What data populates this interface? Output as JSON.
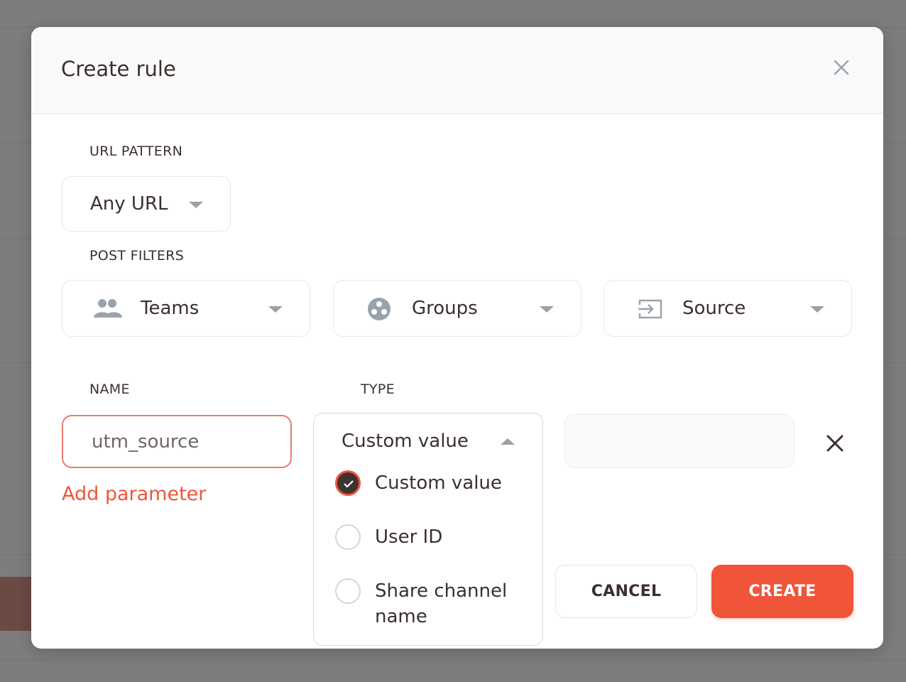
{
  "modal": {
    "title": "Create rule"
  },
  "url_pattern": {
    "label": "URL PATTERN",
    "value": "Any URL"
  },
  "post_filters": {
    "label": "POST FILTERS",
    "items": [
      {
        "label": "Teams",
        "icon": "people-icon"
      },
      {
        "label": "Groups",
        "icon": "groups-icon"
      },
      {
        "label": "Source",
        "icon": "source-icon"
      }
    ]
  },
  "name_field": {
    "label": "NAME",
    "value": "utm_source"
  },
  "type_field": {
    "label": "TYPE",
    "selected": "Custom value",
    "options": [
      {
        "label": "Custom value",
        "checked": true
      },
      {
        "label": "User ID",
        "checked": false
      },
      {
        "label": "Share channel name",
        "checked": false
      }
    ]
  },
  "add_parameter": "Add parameter",
  "buttons": {
    "cancel": "CANCEL",
    "create": "CREATE"
  },
  "colors": {
    "accent": "#f0553a",
    "text": "#3b302d",
    "border": "#e8e8e8"
  }
}
